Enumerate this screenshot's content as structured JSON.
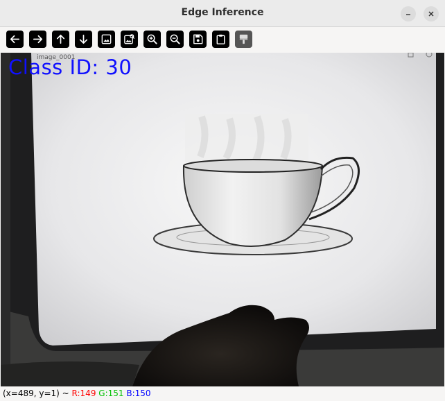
{
  "window": {
    "title": "Edge Inference"
  },
  "titlebar_buttons": {
    "minimize_icon": "minimize-icon",
    "close_icon": "close-icon"
  },
  "toolbar": {
    "buttons": [
      {
        "name": "pan-left-button",
        "icon": "arrow-left-icon"
      },
      {
        "name": "pan-right-button",
        "icon": "arrow-right-icon"
      },
      {
        "name": "pan-up-button",
        "icon": "arrow-up-icon"
      },
      {
        "name": "pan-down-button",
        "icon": "arrow-down-icon"
      },
      {
        "name": "zoom-fit-button",
        "icon": "image-icon"
      },
      {
        "name": "zoom-original-button",
        "icon": "image-search-icon"
      },
      {
        "name": "zoom-in-button",
        "icon": "zoom-in-icon"
      },
      {
        "name": "zoom-out-button",
        "icon": "zoom-out-icon"
      },
      {
        "name": "save-button",
        "icon": "save-icon"
      },
      {
        "name": "copy-button",
        "icon": "clipboard-icon"
      },
      {
        "name": "properties-button",
        "icon": "paint-brush-icon"
      }
    ]
  },
  "image": {
    "overlay_text": "Class ID: 30",
    "screen_tab_label": "image_0001"
  },
  "status": {
    "coords": "(x=489, y=1) ~ ",
    "r": "R:149",
    "g": "G:151",
    "b": "B:150",
    "colors": {
      "r": "#ff0000",
      "g": "#00c000",
      "b": "#0000ff"
    }
  }
}
